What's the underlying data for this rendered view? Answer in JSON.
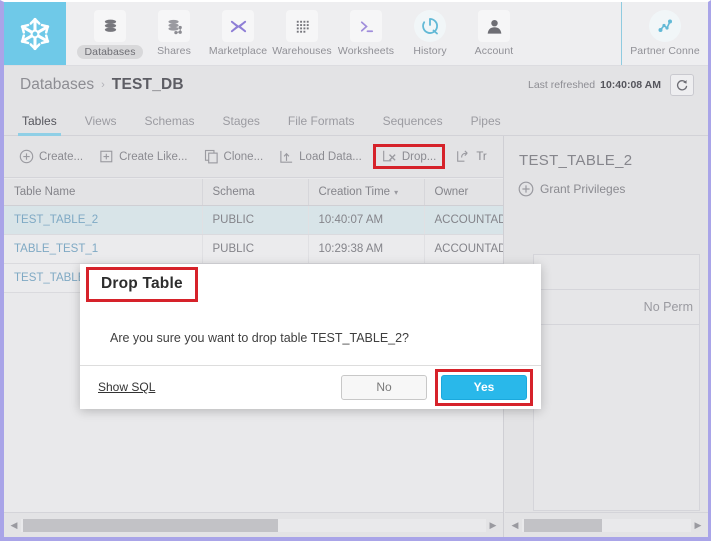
{
  "topnav": {
    "logo": "snowflake-logo",
    "items": [
      {
        "label": "Databases",
        "icon": "databases-icon",
        "active": true
      },
      {
        "label": "Shares",
        "icon": "shares-icon",
        "active": false
      },
      {
        "label": "Marketplace",
        "icon": "marketplace-icon",
        "active": false
      },
      {
        "label": "Warehouses",
        "icon": "warehouses-icon",
        "active": false
      },
      {
        "label": "Worksheets",
        "icon": "worksheets-icon",
        "active": false
      },
      {
        "label": "History",
        "icon": "history-icon",
        "active": false
      },
      {
        "label": "Account",
        "icon": "account-icon",
        "active": false
      }
    ],
    "partner": {
      "label": "Partner Conne",
      "icon": "partner-connect-icon"
    }
  },
  "breadcrumb": {
    "root": "Databases",
    "separator": "›",
    "current": "TEST_DB",
    "refresh_label": "Last refreshed",
    "refresh_time": "10:40:08 AM",
    "refresh_icon": "refresh-icon"
  },
  "tabs": [
    {
      "label": "Tables",
      "active": true
    },
    {
      "label": "Views",
      "active": false
    },
    {
      "label": "Schemas",
      "active": false
    },
    {
      "label": "Stages",
      "active": false
    },
    {
      "label": "File Formats",
      "active": false
    },
    {
      "label": "Sequences",
      "active": false
    },
    {
      "label": "Pipes",
      "active": false
    }
  ],
  "toolbar": [
    {
      "label": "Create...",
      "icon": "plus-circle-icon",
      "highlighted": false
    },
    {
      "label": "Create Like...",
      "icon": "create-like-icon",
      "highlighted": false
    },
    {
      "label": "Clone...",
      "icon": "clone-icon",
      "highlighted": false
    },
    {
      "label": "Load Data...",
      "icon": "load-data-icon",
      "highlighted": false
    },
    {
      "label": "Drop...",
      "icon": "drop-icon",
      "highlighted": true
    },
    {
      "label": "Tr",
      "icon": "transfer-icon",
      "highlighted": false
    }
  ],
  "table": {
    "columns": [
      "Table Name",
      "Schema",
      "Creation Time",
      "Owner"
    ],
    "sort_column": "Creation Time",
    "sort_caret": "▾",
    "rows": [
      {
        "name": "TEST_TABLE_2",
        "schema": "PUBLIC",
        "created": "10:40:07 AM",
        "owner": "ACCOUNTADMI",
        "selected": true
      },
      {
        "name": "TABLE_TEST_1",
        "schema": "PUBLIC",
        "created": "10:29:38 AM",
        "owner": "ACCOUNTADMI",
        "selected": false
      },
      {
        "name": "TEST_TABLE",
        "schema": "",
        "created": "",
        "owner": "",
        "selected": false
      }
    ]
  },
  "right_panel": {
    "title": "TEST_TABLE_2",
    "grant_label": "Grant Privileges",
    "grant_icon": "plus-circle-icon",
    "no_permissions": "No Perm"
  },
  "modal": {
    "title": "Drop Table",
    "message": "Are you sure you want to drop table TEST_TABLE_2?",
    "show_sql": "Show SQL",
    "no_label": "No",
    "yes_label": "Yes"
  },
  "colors": {
    "accent_blue": "#29b8ea",
    "highlight_red": "#d6222a",
    "logo_bg": "#6fc9e8",
    "tab_underline": "#8fcfe6",
    "page_border": "#a9a4e8"
  },
  "scrollbars": {
    "left_arrow": "◀",
    "right_arrow": "▶"
  }
}
